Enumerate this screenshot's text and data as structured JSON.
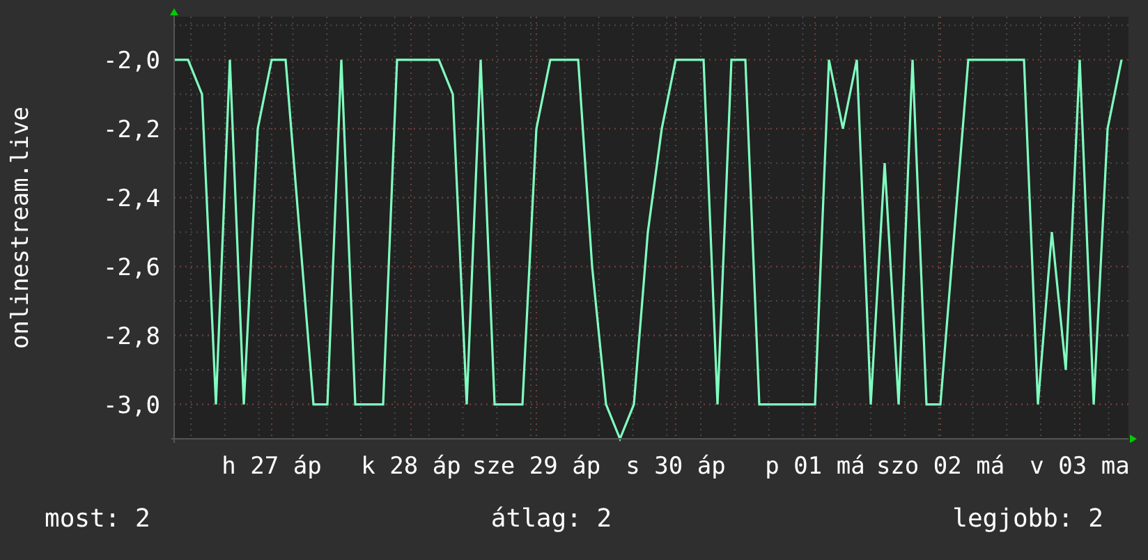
{
  "graph": {
    "chart_data": {
      "type": "line",
      "ylabel": "onlinestream.live",
      "grid": true,
      "categories": [
        null,
        null,
        null,
        null,
        null,
        null,
        null,
        "h 27 áp",
        null,
        null,
        null,
        null,
        null,
        null,
        null,
        null,
        null,
        "k 28 áp",
        null,
        null,
        null,
        null,
        null,
        null,
        null,
        null,
        "sze 29 áp",
        null,
        null,
        null,
        null,
        null,
        null,
        null,
        null,
        null,
        "s 30 áp",
        null,
        null,
        null,
        null,
        null,
        null,
        null,
        null,
        null,
        "p 01 má",
        null,
        null,
        null,
        null,
        null,
        null,
        null,
        null,
        "szo 02 má",
        null,
        null,
        null,
        null,
        null,
        null,
        null,
        null,
        null,
        "v 03 ma",
        null,
        null,
        null
      ],
      "ylim": [
        -3.1,
        -1.875
      ],
      "yticks": [
        {
          "value": -2.0,
          "label": "-2,0"
        },
        {
          "value": -2.2,
          "label": "-2,2"
        },
        {
          "value": -2.4,
          "label": "-2,4"
        },
        {
          "value": -2.6,
          "label": "-2,6"
        },
        {
          "value": -2.8,
          "label": "-2,8"
        },
        {
          "value": -3.0,
          "label": "-3,0"
        }
      ],
      "series": [
        {
          "color": "#80ffc0",
          "values": [
            -2.0,
            -2.0,
            -2.1,
            -3.0,
            -2.0,
            -3.0,
            -2.2,
            -2.0,
            -2.0,
            -2.5,
            -3.0,
            -3.0,
            -2.0,
            -3.0,
            -3.0,
            -3.0,
            -2.0,
            -2.0,
            -2.0,
            -2.0,
            -2.1,
            -3.0,
            -2.0,
            -3.0,
            -3.0,
            -3.0,
            -2.2,
            -2.0,
            -2.0,
            -2.0,
            -2.6,
            -3.0,
            -3.1,
            -3.0,
            -2.5,
            -2.2,
            -2.0,
            -2.0,
            -2.0,
            -3.0,
            -2.0,
            -2.0,
            -3.0,
            -3.0,
            -3.0,
            -3.0,
            -3.0,
            -2.0,
            -2.2,
            -2.0,
            -3.0,
            -2.3,
            -3.0,
            -2.0,
            -3.0,
            -3.0,
            -2.5,
            -2.0,
            -2.0,
            -2.0,
            -2.0,
            -2.0,
            -3.0,
            -2.5,
            -2.9,
            -2.0,
            -3.0,
            -2.2,
            -2.0
          ]
        }
      ]
    }
  },
  "legend": [
    "most: 2",
    "átlag: 2",
    "legjobb: 2"
  ]
}
